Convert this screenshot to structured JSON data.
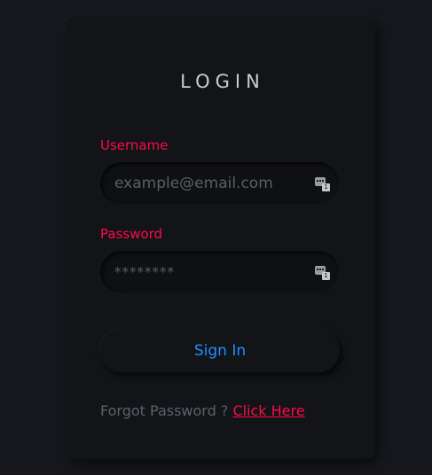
{
  "login": {
    "title": "LOGIN",
    "username_label": "Username",
    "username_placeholder": "example@email.com",
    "password_label": "Password",
    "password_value": "********",
    "sign_in_label": "Sign In",
    "forgot_text": "Forgot Password ?",
    "forgot_link": "Click Here"
  },
  "icons": {
    "username_field_icon": "password-manager-key-icon",
    "password_field_icon": "password-manager-key-icon"
  },
  "colors": {
    "background": "#16181d",
    "card": "#121418",
    "accent_red": "#ff0a47",
    "accent_blue": "#1e90ff",
    "muted_text": "#5e616a",
    "title_text": "#c9cbd2"
  }
}
